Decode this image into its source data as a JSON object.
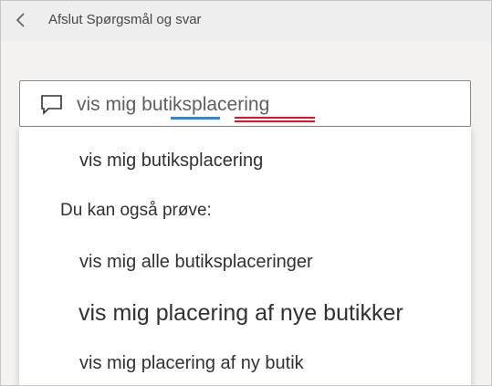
{
  "header": {
    "back_icon": "chevron-left-icon",
    "title": "Afslut Spørgsmål og svar"
  },
  "search": {
    "icon": "chat-bubble-icon",
    "value": "vis mig butiksplacering",
    "underline_colors": {
      "recognized_term": "#2b88d8",
      "unrecognized_term": "#e81123"
    }
  },
  "suggestions": {
    "current": "vis mig butiksplacering",
    "also_try_heading": "Du kan også prøve:",
    "items": [
      "vis mig alle butiksplaceringer",
      "vis mig placering af nye butikker",
      "vis mig placering af ny butik"
    ]
  },
  "colors": {
    "accent_blue": "#2b88d8",
    "error_red": "#e81123",
    "header_bg": "#eeeeee",
    "canvas_bg": "#f3f2f1"
  }
}
